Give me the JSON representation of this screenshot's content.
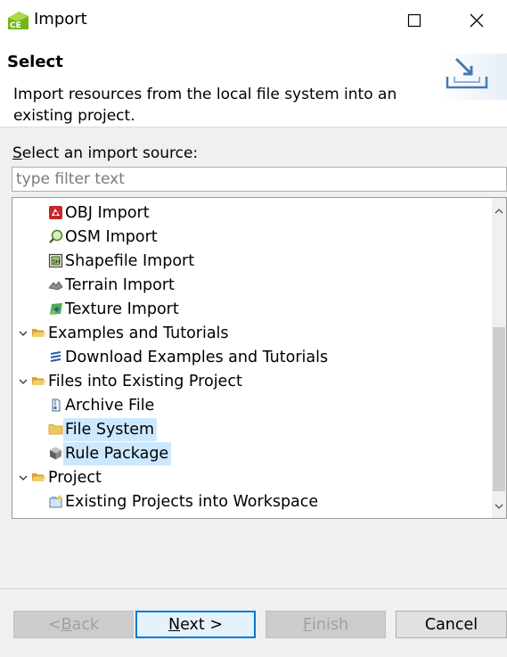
{
  "window": {
    "title": "Import",
    "app_icon_text": "CE"
  },
  "header": {
    "title": "Select",
    "description": "Import resources from the local file system into an existing project."
  },
  "source_label": {
    "underlined": "S",
    "rest": "elect an import source:"
  },
  "filter": {
    "placeholder": "type filter text",
    "value": ""
  },
  "tree": {
    "items": [
      {
        "label": "OBJ Import",
        "icon": "obj-import-icon",
        "level": 1
      },
      {
        "label": "OSM Import",
        "icon": "osm-import-icon",
        "level": 1
      },
      {
        "label": "Shapefile Import",
        "icon": "shapefile-import-icon",
        "level": 1
      },
      {
        "label": "Terrain Import",
        "icon": "terrain-import-icon",
        "level": 1
      },
      {
        "label": "Texture Import",
        "icon": "texture-import-icon",
        "level": 1
      },
      {
        "label": "Examples and Tutorials",
        "icon": "folder-open-icon",
        "level": 0,
        "expanded": true
      },
      {
        "label": "Download Examples and Tutorials",
        "icon": "download-examples-icon",
        "level": 1
      },
      {
        "label": "Files into Existing Project",
        "icon": "folder-open-icon",
        "level": 0,
        "expanded": true
      },
      {
        "label": "Archive File",
        "icon": "archive-file-icon",
        "level": 1
      },
      {
        "label": "File System",
        "icon": "folder-icon",
        "level": 1,
        "selected": true
      },
      {
        "label": "Rule Package",
        "icon": "rule-package-icon",
        "level": 1,
        "selected": true
      },
      {
        "label": "Project",
        "icon": "folder-open-icon",
        "level": 0,
        "expanded": true
      },
      {
        "label": "Existing Projects into Workspace",
        "icon": "existing-projects-icon",
        "level": 1
      }
    ]
  },
  "buttons": {
    "back": {
      "prefix": "< ",
      "mnemonic": "B",
      "rest": "ack",
      "enabled": false
    },
    "next": {
      "mnemonic": "N",
      "rest": "ext >",
      "enabled": true
    },
    "finish": {
      "mnemonic": "F",
      "rest": "inish",
      "enabled": false
    },
    "cancel": {
      "label": "Cancel",
      "enabled": true
    }
  },
  "colors": {
    "selection": "#cce8ff",
    "default_button_border": "#0078d7",
    "folder": "#e8b440"
  }
}
